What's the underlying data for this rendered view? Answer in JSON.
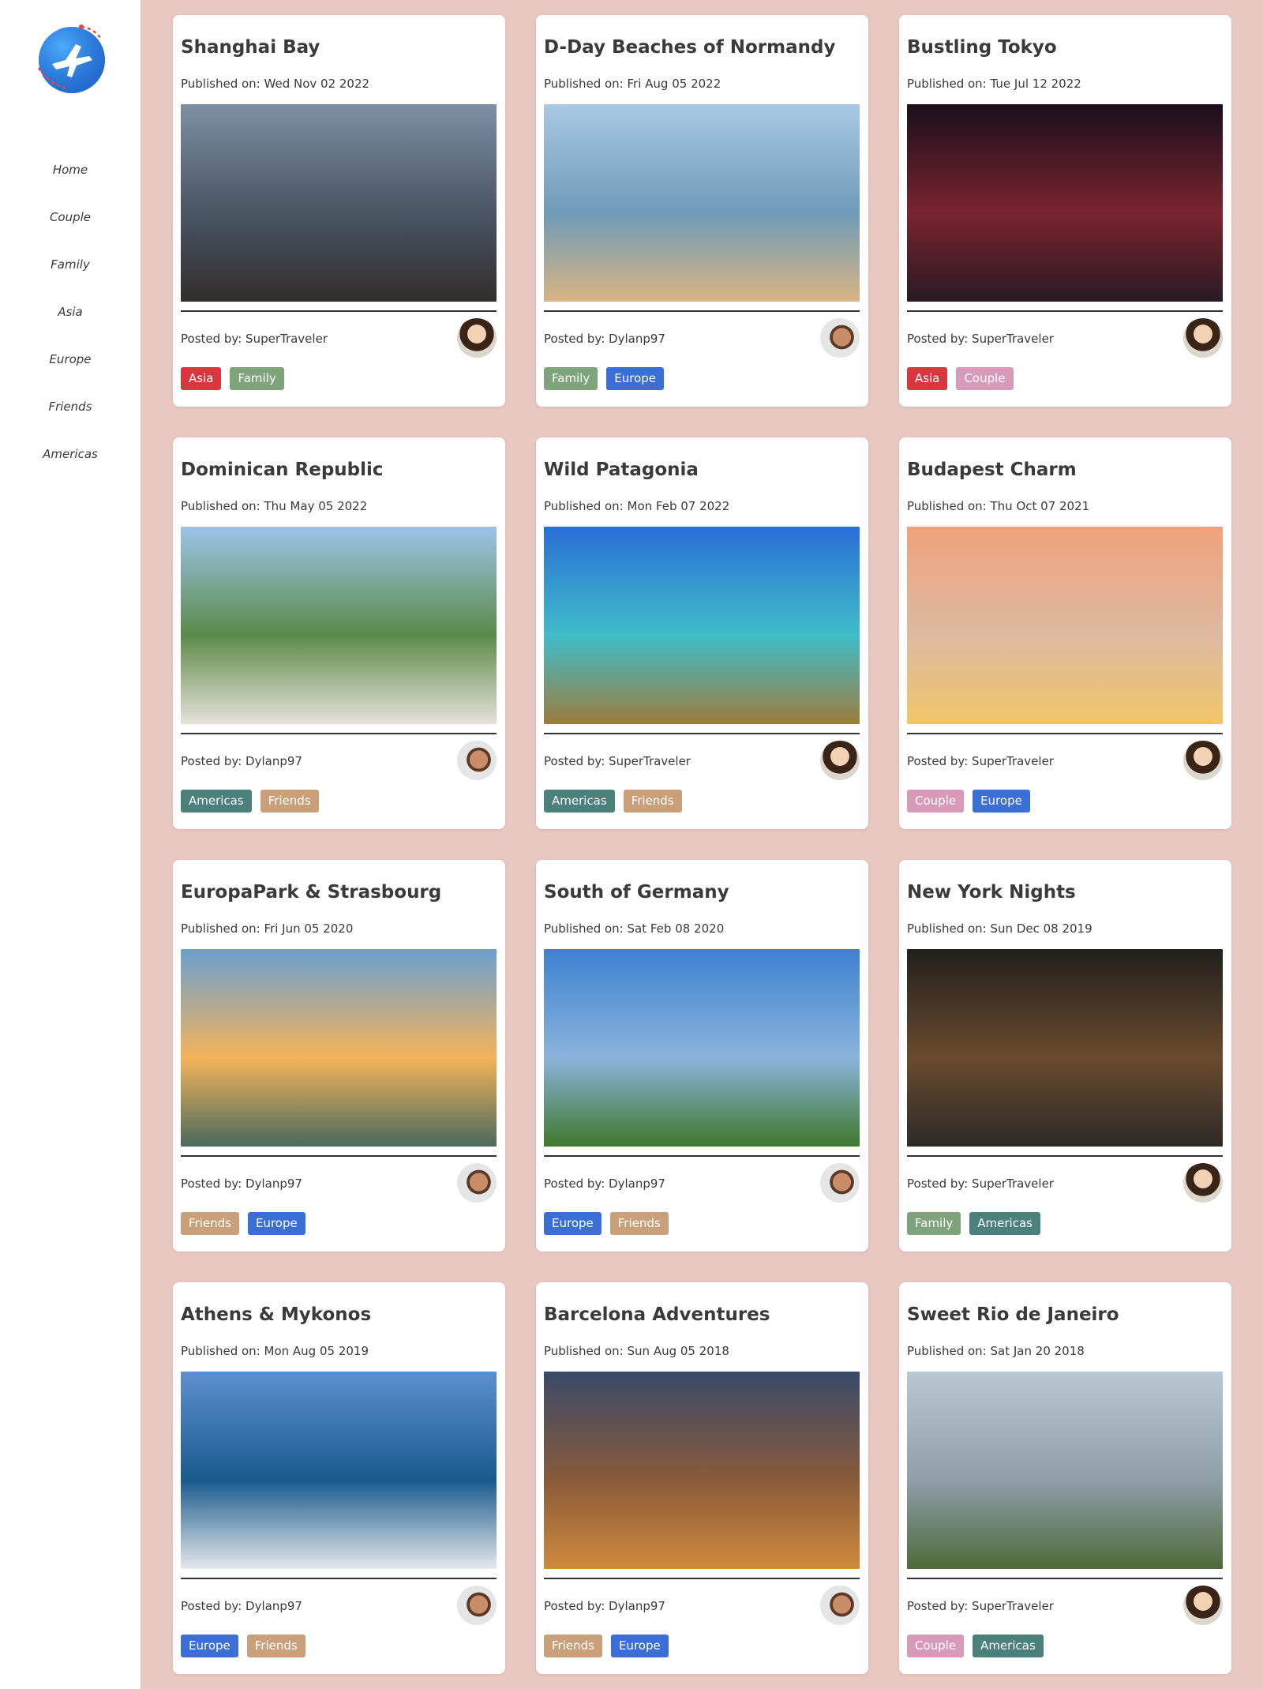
{
  "nav": {
    "items": [
      "Home",
      "Couple",
      "Family",
      "Asia",
      "Europe",
      "Friends",
      "Americas"
    ]
  },
  "tag_colors": {
    "Asia": "#d9363e",
    "Family": "#7fa37b",
    "Europe": "#3b6fd6",
    "Couple": "#d99aba",
    "Americas": "#4c807b",
    "Friends": "#c9a07a"
  },
  "date_label": "Published on:",
  "poster_label": "Posted by:",
  "posts": [
    {
      "title": "Shanghai Bay",
      "date": "Wed Nov 02 2022",
      "author": "SuperTraveler",
      "avatar": "woman-avatar",
      "tags": [
        "Asia",
        "Family"
      ],
      "image_colors": [
        "#7e8fa5",
        "#4a5565",
        "#332d2c"
      ]
    },
    {
      "title": "D-Day Beaches of Normandy",
      "date": "Fri Aug 05 2022",
      "author": "Dylanp97",
      "avatar": "man-avatar",
      "tags": [
        "Family",
        "Europe"
      ],
      "image_colors": [
        "#a9c8e3",
        "#6e9bb8",
        "#d9b383"
      ]
    },
    {
      "title": "Bustling Tokyo",
      "date": "Tue Jul 12 2022",
      "author": "SuperTraveler",
      "avatar": "woman-avatar",
      "tags": [
        "Asia",
        "Couple"
      ],
      "image_colors": [
        "#1b0f1c",
        "#7a2430",
        "#2a1a24"
      ]
    },
    {
      "title": "Dominican Republic",
      "date": "Thu May 05 2022",
      "author": "Dylanp97",
      "avatar": "man-avatar",
      "tags": [
        "Americas",
        "Friends"
      ],
      "image_colors": [
        "#9cc3e8",
        "#5c8a4a",
        "#e6e2da"
      ]
    },
    {
      "title": "Wild Patagonia",
      "date": "Mon Feb 07 2022",
      "author": "SuperTraveler",
      "avatar": "woman-avatar",
      "tags": [
        "Americas",
        "Friends"
      ],
      "image_colors": [
        "#2a6fd6",
        "#3fbcc9",
        "#9c7c3c"
      ]
    },
    {
      "title": "Budapest Charm",
      "date": "Thu Oct 07 2021",
      "author": "SuperTraveler",
      "avatar": "woman-avatar",
      "tags": [
        "Couple",
        "Europe"
      ],
      "image_colors": [
        "#f0a27c",
        "#ddb9a0",
        "#f2c56a"
      ]
    },
    {
      "title": "EuropaPark & Strasbourg",
      "date": "Fri Jun 05 2020",
      "author": "Dylanp97",
      "avatar": "man-avatar",
      "tags": [
        "Friends",
        "Europe"
      ],
      "image_colors": [
        "#6aa0d0",
        "#f4b35a",
        "#4a6a5c"
      ]
    },
    {
      "title": "South of Germany",
      "date": "Sat Feb 08 2020",
      "author": "Dylanp97",
      "avatar": "man-avatar",
      "tags": [
        "Europe",
        "Friends"
      ],
      "image_colors": [
        "#3e82d0",
        "#8ab3dc",
        "#3f7a2c"
      ]
    },
    {
      "title": "New York Nights",
      "date": "Sun Dec 08 2019",
      "author": "SuperTraveler",
      "avatar": "woman-avatar",
      "tags": [
        "Family",
        "Americas"
      ],
      "image_colors": [
        "#22201e",
        "#6a4a2e",
        "#2e2a28"
      ]
    },
    {
      "title": "Athens & Mykonos",
      "date": "Mon Aug 05 2019",
      "author": "Dylanp97",
      "avatar": "man-avatar",
      "tags": [
        "Europe",
        "Friends"
      ],
      "image_colors": [
        "#5d8fd0",
        "#1a5a8c",
        "#e6e8ec"
      ]
    },
    {
      "title": "Barcelona Adventures",
      "date": "Sun Aug 05 2018",
      "author": "Dylanp97",
      "avatar": "man-avatar",
      "tags": [
        "Friends",
        "Europe"
      ],
      "image_colors": [
        "#3a4a6a",
        "#8a5a3a",
        "#d08a3c"
      ]
    },
    {
      "title": "Sweet Rio de Janeiro",
      "date": "Sat Jan 20 2018",
      "author": "SuperTraveler",
      "avatar": "woman-avatar",
      "tags": [
        "Couple",
        "Americas"
      ],
      "image_colors": [
        "#b9c7d3",
        "#8f9ea8",
        "#4e6a3a"
      ]
    }
  ]
}
